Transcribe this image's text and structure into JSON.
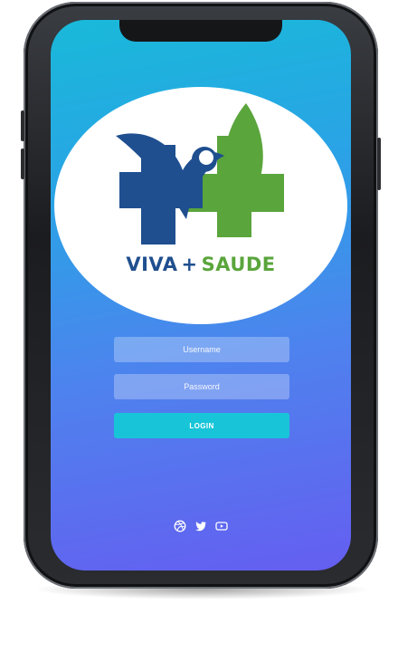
{
  "app": {
    "brand_left": "VIVA",
    "brand_plus": "+",
    "brand_right": "SAUDE"
  },
  "form": {
    "username_placeholder": "Username",
    "password_placeholder": "Password",
    "login_label": "LOGIN"
  },
  "social": {
    "icons": [
      "dribbble-icon",
      "twitter-icon",
      "youtube-icon"
    ]
  },
  "colors": {
    "brand_blue": "#1f4f8f",
    "brand_green": "#5aa53c",
    "gradient_top": "#19b9d9",
    "gradient_bottom": "#655ef0",
    "button": "#18c5d8"
  }
}
